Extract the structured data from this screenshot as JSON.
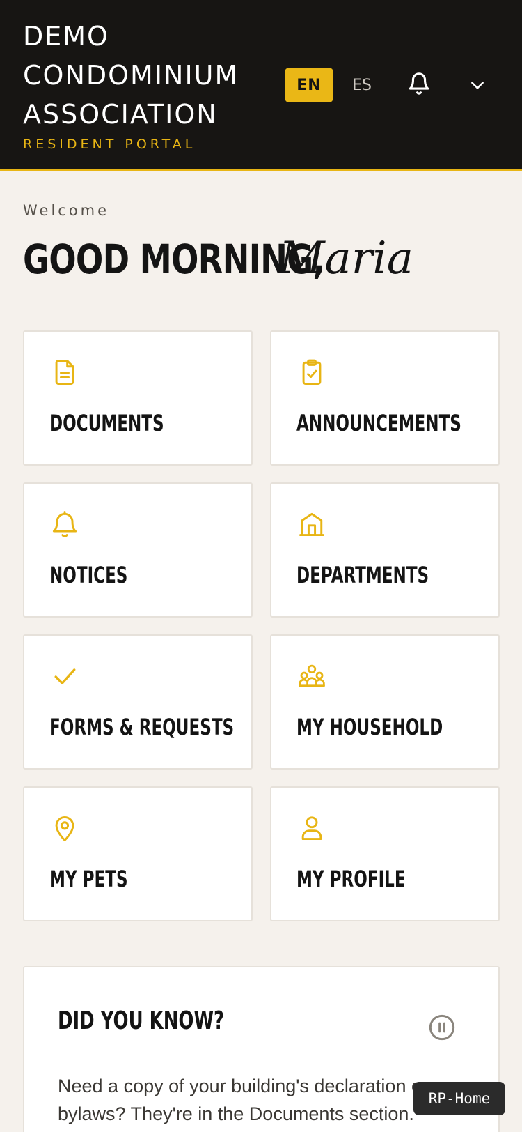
{
  "header": {
    "brand_lines": [
      "DEMO",
      "CONDOMINIUM",
      "ASSOCIATION"
    ],
    "portal_label": "RESIDENT PORTAL",
    "lang_active": "EN",
    "lang_other": "ES",
    "accent_color": "#e8b514",
    "background_color": "#171513"
  },
  "welcome": {
    "eyebrow": "Welcome",
    "greeting": "GOOD MORNING,",
    "name": "Maria"
  },
  "tiles": [
    {
      "label": "DOCUMENTS",
      "icon": "document-icon"
    },
    {
      "label": "ANNOUNCEMENTS",
      "icon": "clipboard-check-icon"
    },
    {
      "label": "NOTICES",
      "icon": "bell-icon"
    },
    {
      "label": "DEPARTMENTS",
      "icon": "building-icon"
    },
    {
      "label": "FORMS & REQUESTS",
      "icon": "check-icon"
    },
    {
      "label": "MY HOUSEHOLD",
      "icon": "group-icon"
    },
    {
      "label": "MY PETS",
      "icon": "map-pin-icon"
    },
    {
      "label": "MY PROFILE",
      "icon": "user-icon"
    }
  ],
  "did_you_know": {
    "title": "DID YOU KNOW?",
    "text": "Need a copy of your building's declaration or bylaws? They're in the Documents section."
  },
  "badge": {
    "label": "RP-Home"
  }
}
